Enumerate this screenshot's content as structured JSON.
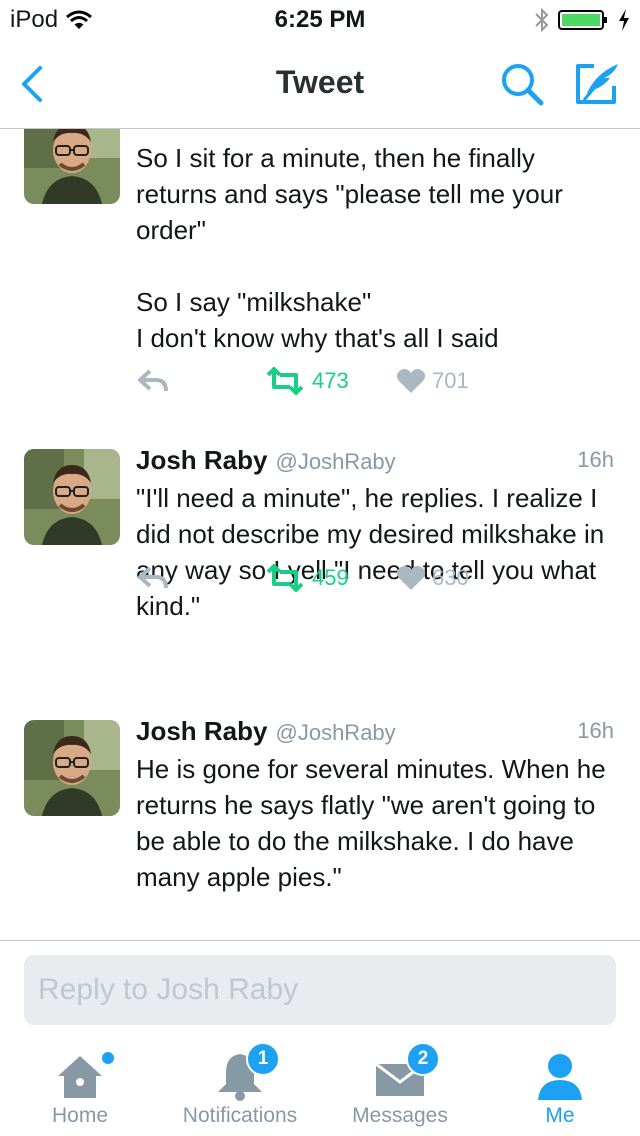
{
  "status_bar": {
    "carrier": "iPod",
    "time": "6:25 PM"
  },
  "nav": {
    "title": "Tweet"
  },
  "tweets": [
    {
      "text": "So I sit for a minute, then he finally returns and says \"please tell me your order\"\n\nSo I say \"milkshake\"\nI don't know why that's all I said",
      "retweets": "473",
      "likes": "701"
    },
    {
      "name": "Josh Raby",
      "handle": "@JoshRaby",
      "time": "16h",
      "text": "\"I'll need a minute\", he replies. I realize I did not describe my desired milkshake in any way so I yell \"I need to tell you what kind.\"",
      "retweets": "459",
      "likes": "630"
    },
    {
      "name": "Josh Raby",
      "handle": "@JoshRaby",
      "time": "16h",
      "text": "He is gone for several minutes. When he returns he says flatly \"we aren't going to be able to do the milkshake. I do have many apple pies.\""
    }
  ],
  "reply": {
    "placeholder": "Reply to Josh Raby"
  },
  "tabs": [
    {
      "label": "Home"
    },
    {
      "label": "Notifications",
      "badge": "1"
    },
    {
      "label": "Messages",
      "badge": "2"
    },
    {
      "label": "Me"
    }
  ],
  "colors": {
    "accent": "#1da1f2",
    "retweet": "#19cf86",
    "muted": "#8899a6",
    "like_inactive": "#aab8c2"
  }
}
